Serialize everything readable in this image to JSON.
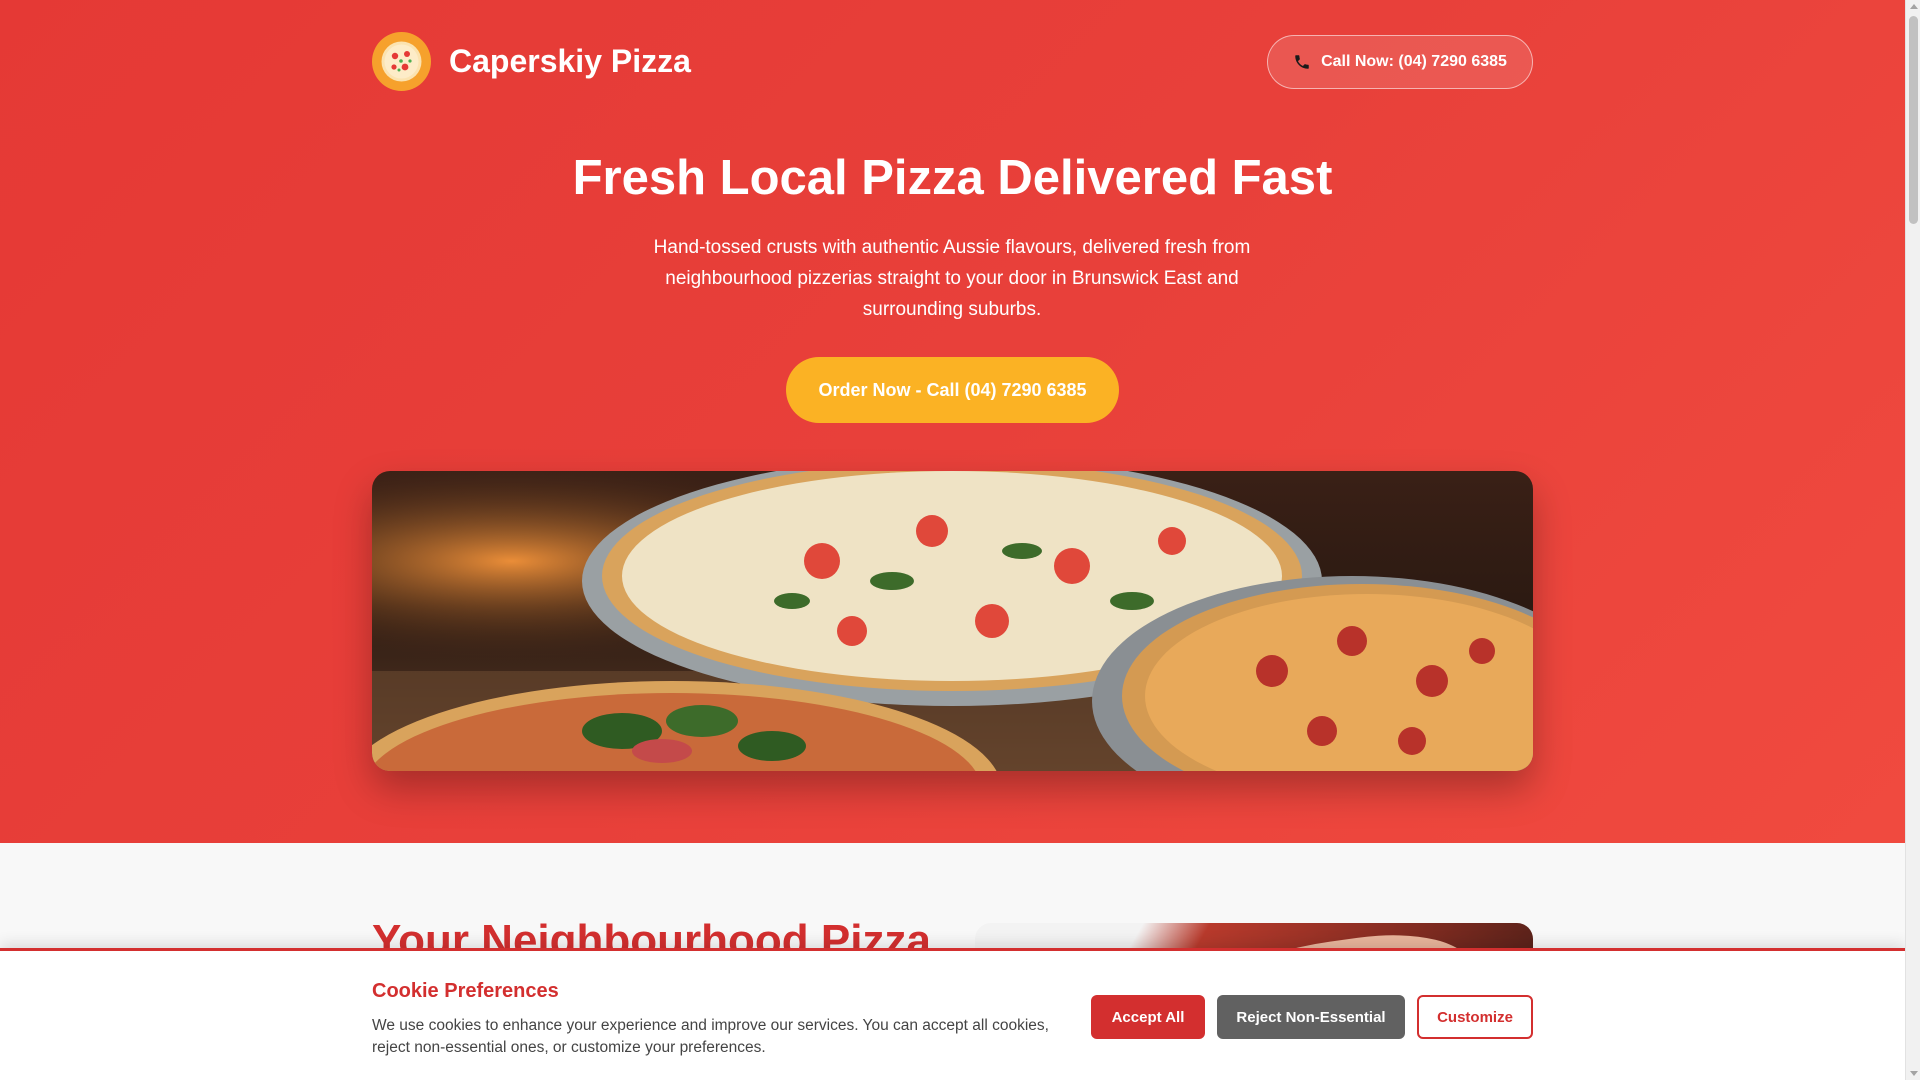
{
  "header": {
    "brand": "Caperskiy Pizza",
    "call_button": "Call Now: (04) 7290 6385",
    "logo_icon": "pizza-icon",
    "phone_icon": "phone-icon"
  },
  "hero": {
    "title": "Fresh Local Pizza Delivered Fast",
    "subtitle": "Hand-tossed crusts with authentic Aussie flavours, delivered fresh from neighbourhood pizzerias straight to your door in Brunswick East and surrounding suburbs.",
    "order_button": "Order Now - Call (04) 7290 6385"
  },
  "section2": {
    "title": "Your Neighbourhood Pizza"
  },
  "cookie": {
    "title": "Cookie Preferences",
    "text": "We use cookies to enhance your experience and improve our services. You can accept all cookies, reject non-essential ones, or customize your preferences.",
    "accept": "Accept All",
    "reject": "Reject Non-Essential",
    "customize": "Customize"
  },
  "colors": {
    "primary_red": "#e53935",
    "accent_orange": "#fbb224",
    "cookie_red": "#d32f2f",
    "reject_gray": "#616161"
  }
}
